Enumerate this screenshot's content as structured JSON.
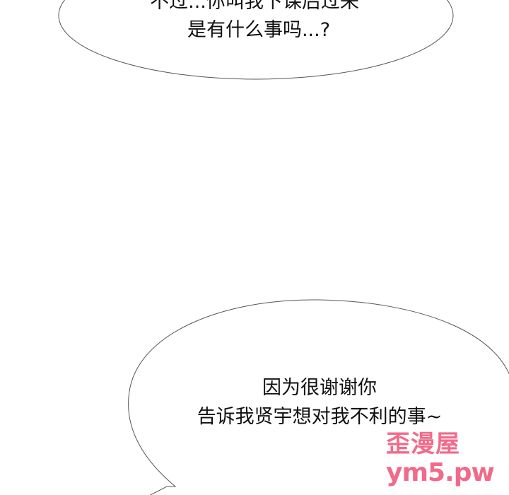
{
  "comic": {
    "bubble_top": {
      "line1": "不过...你叫我下课后过来",
      "line2": "是有什么事吗...?"
    },
    "bubble_bottom": {
      "line1": "因为很谢谢你",
      "line2": "告诉我贤宇想对我不利的事~"
    },
    "watermark": {
      "line1": "歪漫屋",
      "line2": "ym5.pw",
      "color": "#f26a8a"
    }
  }
}
